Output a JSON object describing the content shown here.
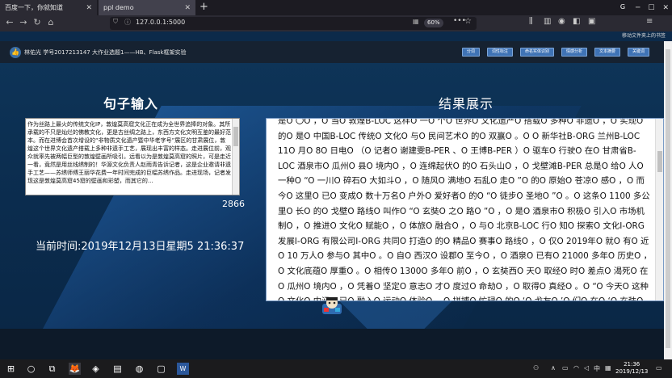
{
  "browser": {
    "tabs": [
      {
        "label": "百度一下，你就知道",
        "close": "✕"
      },
      {
        "label": "ppl demo",
        "close": "✕"
      }
    ],
    "new_tab": "+",
    "url": "127.0.0.1:5000",
    "zoom": "60%",
    "menu": "•••",
    "notice": "移动文件夹上的书签"
  },
  "page": {
    "student": "林佑光 学号2017213147 大作业选题1——HB、Flask框架实验",
    "nav_buttons": [
      "分词",
      "词性标注",
      "命名实体识别",
      "情感分析",
      "文本摘要",
      "关键词"
    ],
    "input_heading": "句子输入",
    "result_heading": "结果展示",
    "input_text": "作为丝路上最火的传统文化IP，敦煌莫高窟文化正在成为全世界追捧的对象。其所承载的不只是灿烂的佛教文化，更是古丝绸之路上，东西方文化文明互鉴的最好范本。而在进博会首次增设的“非物质文化遗产暨中华老字号”展区的甘肃展位，敦煌这个世界文化遗产搭载上多种非遗手工艺，展现出丰富的样态。走进展位前，观众就率先被两幅巨型的敦煌壁画所吸引。远看以为是敦煌莫高窟的照片，可是走近一看，竟然是用丝线绣制的！华源文化负责人赵雨青告诉记者，这是企业邀请非遗手工艺——苏绣师傅王丽华花费一年时间完成的巨幅苏绣作品。走进现场，记者发现这是敦煌莫高窟45窟的壁画和彩塑，而其它的...",
    "char_count": "2866",
    "time_label": "当前时间:2019年12月13日星期5 21:36:37",
    "result_text": "是O 〇O ，O 当O 敦煌B-LOC 这样O 一O 个O 世界O 文化遗产O 搭载O 多种O 非遗O ，O 实现O 的O 是O 中国B-LOC 传统O 文化O 与O 民间艺术O 的O 双赢O 。O O 新华社B-ORG 兰州B-LOC 11O 月O 8O 日电O （O 记者O 谢建雯B-PER 、O 王博B-PER ）O 驱车O 行驶O 在O 甘肃省B-LOC 酒泉市O 瓜州O 县O 境内O ，O 连绵起伏O 的O 石头山O ，O 戈壁滩B-PER 总是O 给O 人O 一种O “O 一川O 碎石O 大如斗O ，O 随风O 满地O 石乱O 走O ”O 的O 原始O 苍凉O 感O ，O 而今O 这里O 已O 变成O 数十万名O 户外O 爱好者O 的O “O 徒步O 圣地O ”O 。O 这条O 1100 多公里O 长O 的O 戈壁O 路线O 叫作O “O 玄奘O 之O 路O ”O ，O 是O 酒泉市O 积极O 引入O 市场机制O ，O 推进O 文化O 赋能O ，O 体旅O 融合O ，O 与O 北京B-LOC 行O 知O 探索O 文化I-ORG 发展I-ORG 有限公司I-ORG 共同O 打造O 的O 精品O 赛事O 路线O ，O 仅O 2019年O 就O 有O 近O 10 万人O 参与O 其中O 。O 自O 西汉O 设郡O 至今O ，O 酒泉O 已有O 21000 多年O 历史O ，O 文化底蕴O 厚重O 。O 相传O 1300O 多年O 前O ，O 玄奘西O 天O 取经O 时O 差点O 渴死O 在O 瓜州O 境内O ，O 凭着O 坚定O 意志O 才O 度过O 命劫O ，O 取得O 真经O 。O “O 今天O 这种O 文化O 内涵O 已O 融入O 运动O 体验O ，O 拼搏O 忙碌O 的O ‘O 戈友O ’O 们O 在O ‘O 玄奘O 之O 路O ’O 的O 极限O"
  },
  "taskbar": {
    "time": "21:36",
    "date": "2019/12/13",
    "lang": "中"
  },
  "colors": {
    "page_bg": "#0c2a4a",
    "button_bg": "#3f73b5",
    "topbar_bg": "#162231"
  }
}
